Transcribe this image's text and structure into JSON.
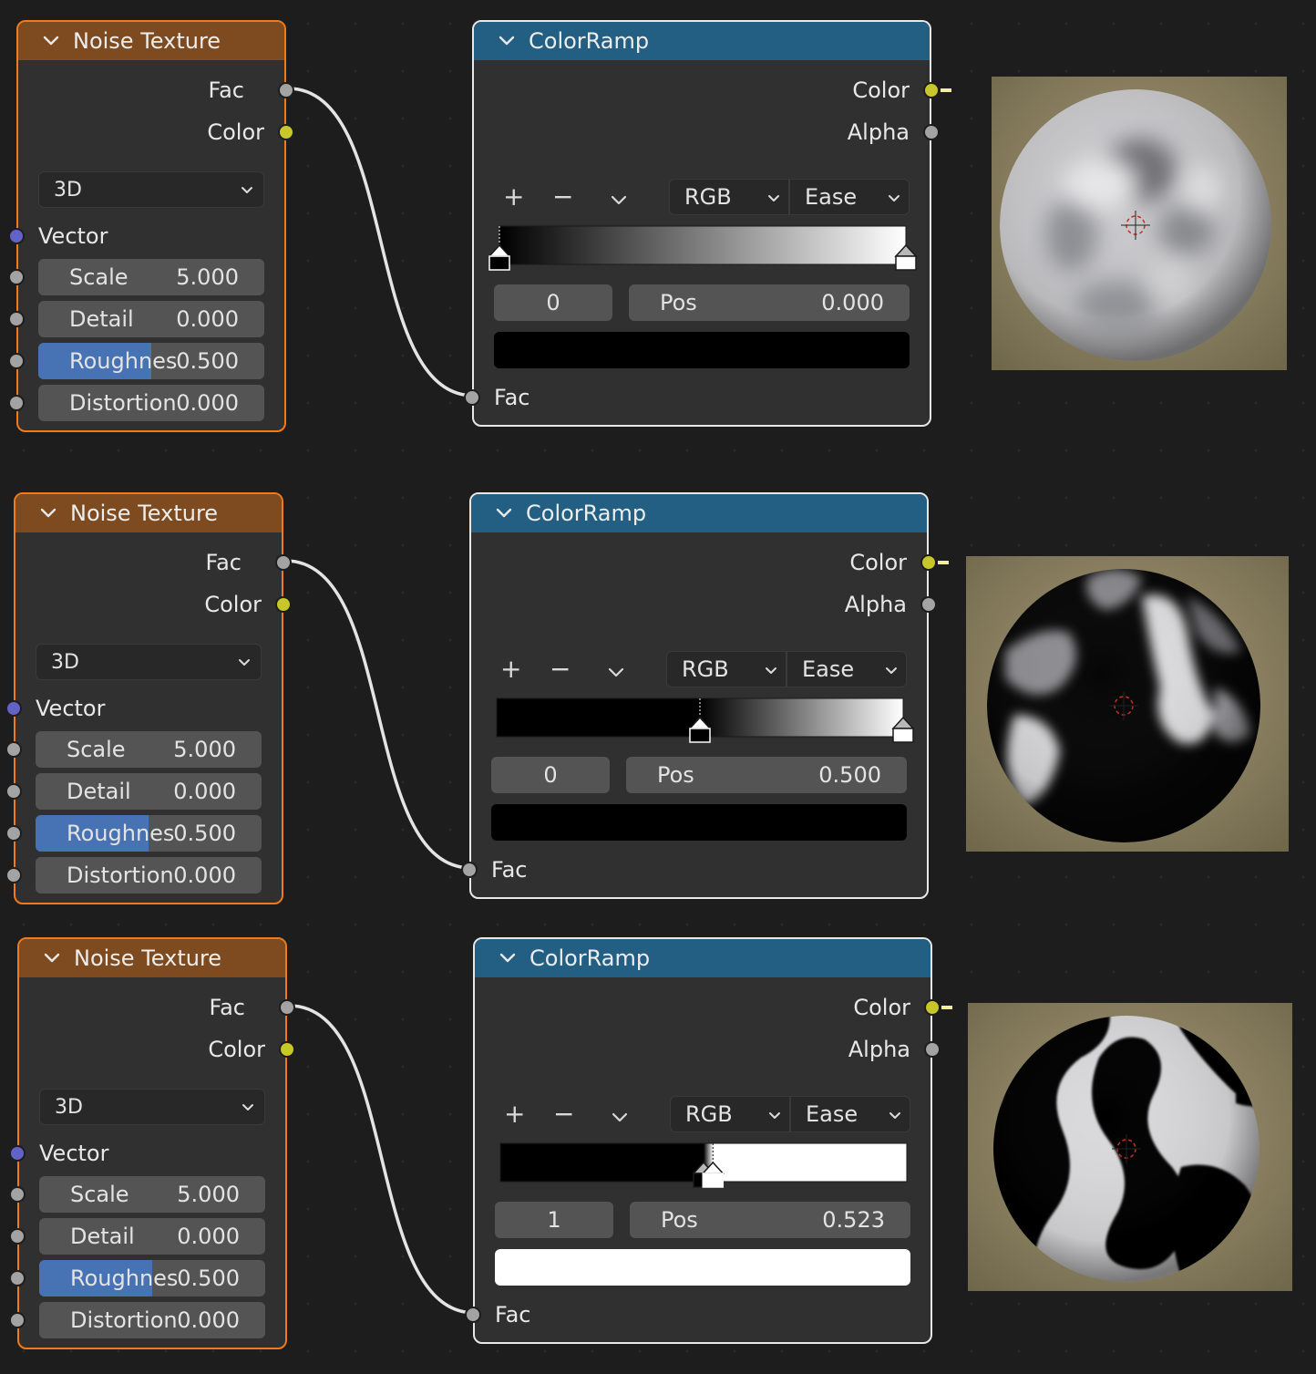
{
  "rows": [
    {
      "noise": {
        "title": "Noise Texture",
        "out_fac": "Fac",
        "out_color": "Color",
        "dimension": "3D",
        "vector_label": "Vector",
        "fields": [
          {
            "name": "Scale",
            "value": "5.000"
          },
          {
            "name": "Detail",
            "value": "0.000"
          },
          {
            "name": "Roughnes",
            "value": "0.500",
            "fill": 0.5
          },
          {
            "name": "Distortion",
            "value": "0.000"
          }
        ]
      },
      "ramp": {
        "title": "ColorRamp",
        "out_color": "Color",
        "out_alpha": "Alpha",
        "plus": "+",
        "minus": "−",
        "color_mode": "RGB",
        "interpolation": "Ease",
        "active_index": "0",
        "pos_label": "Pos",
        "pos_value": "0.000",
        "active_color": "#000000",
        "in_fac": "Fac",
        "stops": [
          {
            "pos": 0.0,
            "color": "#000000",
            "active": true
          },
          {
            "pos": 1.0,
            "color": "#ffffff",
            "active": false
          }
        ]
      },
      "preview": "soft"
    },
    {
      "noise": {
        "title": "Noise Texture",
        "out_fac": "Fac",
        "out_color": "Color",
        "dimension": "3D",
        "vector_label": "Vector",
        "fields": [
          {
            "name": "Scale",
            "value": "5.000"
          },
          {
            "name": "Detail",
            "value": "0.000"
          },
          {
            "name": "Roughnes",
            "value": "0.500",
            "fill": 0.5
          },
          {
            "name": "Distortion",
            "value": "0.000"
          }
        ]
      },
      "ramp": {
        "title": "ColorRamp",
        "out_color": "Color",
        "out_alpha": "Alpha",
        "plus": "+",
        "minus": "−",
        "color_mode": "RGB",
        "interpolation": "Ease",
        "active_index": "0",
        "pos_label": "Pos",
        "pos_value": "0.500",
        "active_color": "#000000",
        "in_fac": "Fac",
        "stops": [
          {
            "pos": 0.5,
            "color": "#000000",
            "active": true
          },
          {
            "pos": 1.0,
            "color": "#ffffff",
            "active": false
          }
        ]
      },
      "preview": "medium"
    },
    {
      "noise": {
        "title": "Noise Texture",
        "out_fac": "Fac",
        "out_color": "Color",
        "dimension": "3D",
        "vector_label": "Vector",
        "fields": [
          {
            "name": "Scale",
            "value": "5.000"
          },
          {
            "name": "Detail",
            "value": "0.000"
          },
          {
            "name": "Roughnes",
            "value": "0.500",
            "fill": 0.5
          },
          {
            "name": "Distortion",
            "value": "0.000"
          }
        ]
      },
      "ramp": {
        "title": "ColorRamp",
        "out_color": "Color",
        "out_alpha": "Alpha",
        "plus": "+",
        "minus": "−",
        "color_mode": "RGB",
        "interpolation": "Ease",
        "active_index": "1",
        "pos_label": "Pos",
        "pos_value": "0.523",
        "active_color": "#ffffff",
        "in_fac": "Fac",
        "stops": [
          {
            "pos": 0.5,
            "color": "#000000",
            "active": false
          },
          {
            "pos": 0.523,
            "color": "#ffffff",
            "active": true
          }
        ]
      },
      "preview": "hard"
    }
  ]
}
